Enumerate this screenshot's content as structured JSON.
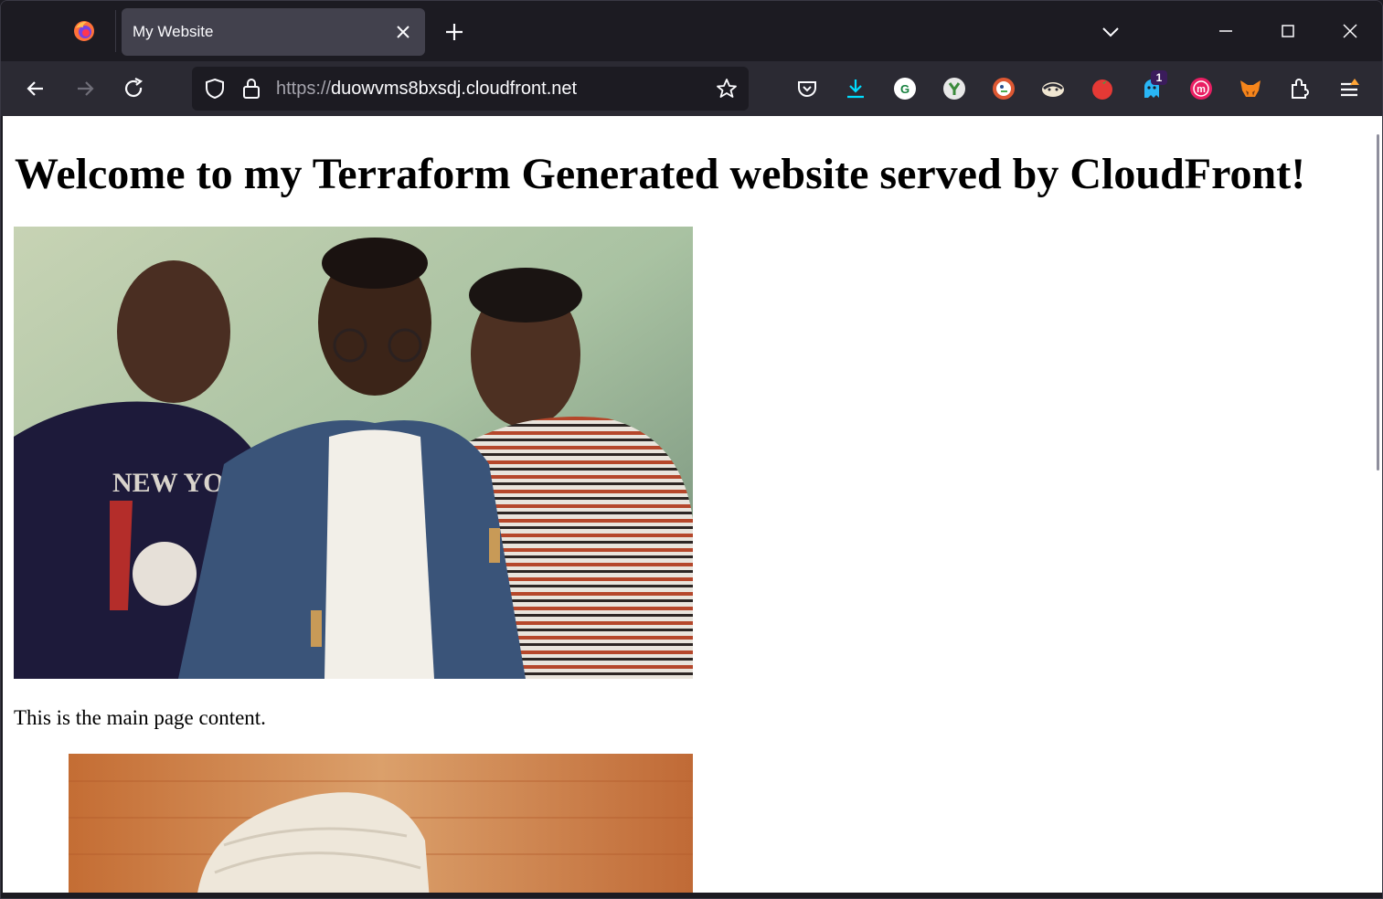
{
  "browser": {
    "tab_title": "My Website",
    "url_scheme": "https://",
    "url_host": "duowvms8bxsdj.cloudfront.net",
    "extension_badge_count": "1",
    "accent_color": "#1c1b22",
    "icons": [
      "firefox-icon",
      "close-icon",
      "plus-icon",
      "chevron-down-icon",
      "minimize-icon",
      "maximize-icon",
      "window-close-icon",
      "back-icon",
      "forward-icon",
      "reload-icon",
      "shield-icon",
      "lock-icon",
      "star-icon",
      "pocket-icon",
      "download-icon",
      "grammarly-icon",
      "yoroi-icon",
      "duckduckgo-icon",
      "badger-icon",
      "tomato-icon",
      "ghost-icon",
      "m-icon",
      "fox-icon",
      "extensions-icon",
      "menu-icon"
    ]
  },
  "page": {
    "heading": "Welcome to my Terraform Generated website served by CloudFront!",
    "paragraph": "This is the main page content."
  }
}
